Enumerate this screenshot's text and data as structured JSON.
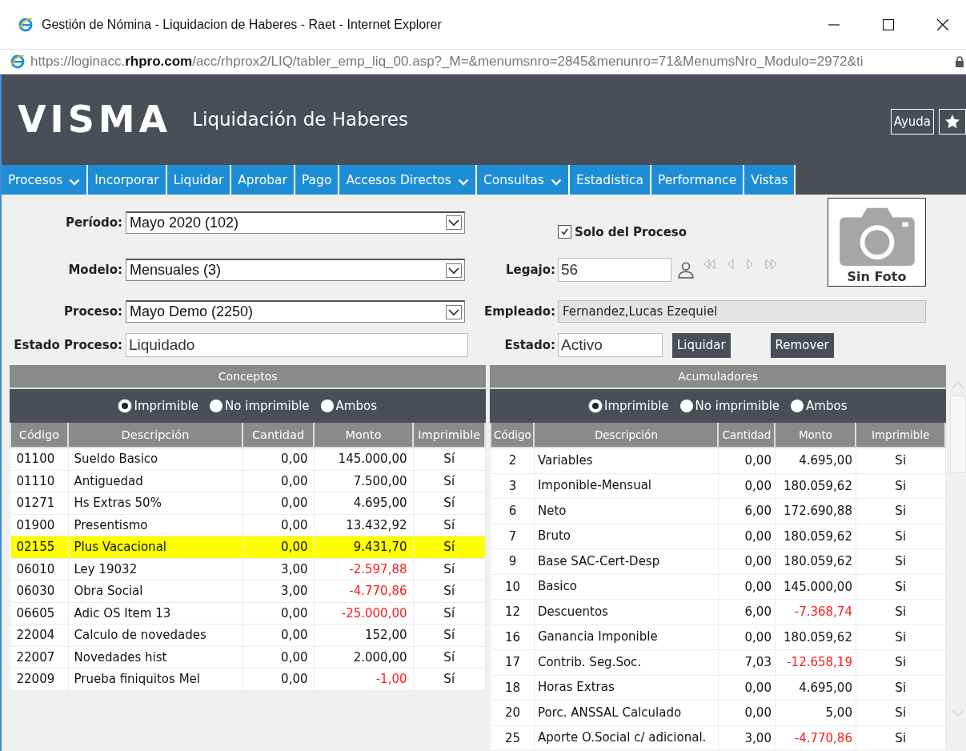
{
  "window": {
    "title": "Gestión de Nómina - Liquidacion de Haberes - Raet - Internet Explorer"
  },
  "address_bar": {
    "url": "https://loginacc.**rhpro.com**/acc/rhprox2/LIQ/tabler_emp_liq_00.asp?_M=&menumsnro=2845&menunro=71&MenumsNro_Modulo=2972&ti"
  },
  "header": {
    "logo": "VISMA",
    "app_title": "Liquidación de Haberes",
    "help_button": "Ayuda"
  },
  "menu": [
    {
      "label": "Procesos",
      "dropdown": true
    },
    {
      "label": "Incorporar",
      "dropdown": false
    },
    {
      "label": "Liquidar",
      "dropdown": false
    },
    {
      "label": "Aprobar",
      "dropdown": false
    },
    {
      "label": "Pago",
      "dropdown": false
    },
    {
      "label": "Accesos Directos",
      "dropdown": true
    },
    {
      "label": "Consultas",
      "dropdown": true
    },
    {
      "label": "Estadistica",
      "dropdown": false
    },
    {
      "label": "Performance",
      "dropdown": false
    },
    {
      "label": "Vistas",
      "dropdown": false
    }
  ],
  "form": {
    "periodo": {
      "label": "Período:",
      "value": "Mayo 2020 (102)"
    },
    "modelo": {
      "label": "Modelo:",
      "value": "Mensuales (3)"
    },
    "proceso": {
      "label": "Proceso:",
      "value": "Mayo Demo (2250)"
    },
    "estado_proceso": {
      "label": "Estado Proceso:",
      "value": "Liquidado"
    },
    "solo_del_proceso": {
      "label": "Solo del Proceso",
      "checked": true
    },
    "legajo": {
      "label": "Legajo:",
      "value": "56"
    },
    "empleado": {
      "label": "Empleado:",
      "value": "Fernandez,Lucas Ezequiel"
    },
    "estado": {
      "label": "Estado:",
      "value": "Activo"
    },
    "buttons": [
      "Liquidar",
      "Remover"
    ],
    "photo": {
      "caption": "Sin Foto"
    }
  },
  "conceptos": {
    "title": "Conceptos",
    "filters": [
      {
        "label": "Imprimible",
        "selected": true
      },
      {
        "label": "No imprimible",
        "selected": false
      },
      {
        "label": "Ambos",
        "selected": false
      }
    ],
    "columns": [
      "Código",
      "Descripción",
      "Cantidad",
      "Monto",
      "Imprimible"
    ],
    "rows": [
      {
        "code": "01100",
        "description": "Sueldo Basico",
        "quantity": "0,00",
        "amount": "145.000,00",
        "printable": "Sí",
        "negative": false,
        "selected": false
      },
      {
        "code": "01110",
        "description": "Antiguedad",
        "quantity": "0,00",
        "amount": "7.500,00",
        "printable": "Sí",
        "negative": false,
        "selected": false
      },
      {
        "code": "01271",
        "description": "Hs Extras 50%",
        "quantity": "0,00",
        "amount": "4.695,00",
        "printable": "Sí",
        "negative": false,
        "selected": false
      },
      {
        "code": "01900",
        "description": "Presentismo",
        "quantity": "0,00",
        "amount": "13.432,92",
        "printable": "Sí",
        "negative": false,
        "selected": false
      },
      {
        "code": "02155",
        "description": "Plus Vacacional",
        "quantity": "0,00",
        "amount": "9.431,70",
        "printable": "Sí",
        "negative": false,
        "selected": true
      },
      {
        "code": "06010",
        "description": "Ley 19032",
        "quantity": "3,00",
        "amount": "-2.597,88",
        "printable": "Sí",
        "negative": true,
        "selected": false
      },
      {
        "code": "06030",
        "description": "Obra Social",
        "quantity": "3,00",
        "amount": "-4.770,86",
        "printable": "Sí",
        "negative": true,
        "selected": false
      },
      {
        "code": "06605",
        "description": "Adic OS Item 13",
        "quantity": "0,00",
        "amount": "-25.000,00",
        "printable": "Sí",
        "negative": true,
        "selected": false
      },
      {
        "code": "22004",
        "description": "Calculo de novedades",
        "quantity": "0,00",
        "amount": "152,00",
        "printable": "Sí",
        "negative": false,
        "selected": false
      },
      {
        "code": "22007",
        "description": "Novedades hist",
        "quantity": "0,00",
        "amount": "2.000,00",
        "printable": "Sí",
        "negative": false,
        "selected": false
      },
      {
        "code": "22009",
        "description": "Prueba finiquitos Mel",
        "quantity": "0,00",
        "amount": "-1,00",
        "printable": "Sí",
        "negative": true,
        "selected": false
      }
    ]
  },
  "acumuladores": {
    "title": "Acumuladores",
    "filters": [
      {
        "label": "Imprimible",
        "selected": true
      },
      {
        "label": "No imprimible",
        "selected": false
      },
      {
        "label": "Ambos",
        "selected": false
      }
    ],
    "columns": [
      "Código",
      "Descripción",
      "Cantidad",
      "Monto",
      "Imprimible"
    ],
    "rows": [
      {
        "code": "2",
        "description": "Variables",
        "quantity": "0,00",
        "amount": "4.695,00",
        "printable": "Si",
        "negative": false
      },
      {
        "code": "3",
        "description": "Imponible-Mensual",
        "quantity": "0,00",
        "amount": "180.059,62",
        "printable": "Si",
        "negative": false
      },
      {
        "code": "6",
        "description": "Neto",
        "quantity": "6,00",
        "amount": "172.690,88",
        "printable": "Si",
        "negative": false
      },
      {
        "code": "7",
        "description": "Bruto",
        "quantity": "0,00",
        "amount": "180.059,62",
        "printable": "Si",
        "negative": false
      },
      {
        "code": "9",
        "description": "Base SAC-Cert-Desp",
        "quantity": "0,00",
        "amount": "180.059,62",
        "printable": "Si",
        "negative": false
      },
      {
        "code": "10",
        "description": "Basico",
        "quantity": "0,00",
        "amount": "145.000,00",
        "printable": "Si",
        "negative": false
      },
      {
        "code": "12",
        "description": "Descuentos",
        "quantity": "6,00",
        "amount": "-7.368,74",
        "printable": "Si",
        "negative": true
      },
      {
        "code": "16",
        "description": "Ganancia Imponible",
        "quantity": "0,00",
        "amount": "180.059,62",
        "printable": "Si",
        "negative": false
      },
      {
        "code": "17",
        "description": "Contrib. Seg.Soc.",
        "quantity": "7,03",
        "amount": "-12.658,19",
        "printable": "Si",
        "negative": true
      },
      {
        "code": "18",
        "description": "Horas Extras",
        "quantity": "0,00",
        "amount": "4.695,00",
        "printable": "Si",
        "negative": false
      },
      {
        "code": "20",
        "description": "Porc. ANSSAL Calculado",
        "quantity": "0,00",
        "amount": "5,00",
        "printable": "Si",
        "negative": false
      },
      {
        "code": "25",
        "description": "Aporte O.Social c/ adicional.",
        "quantity": "3,00",
        "amount": "-4.770,86",
        "printable": "Si",
        "negative": true
      }
    ]
  }
}
